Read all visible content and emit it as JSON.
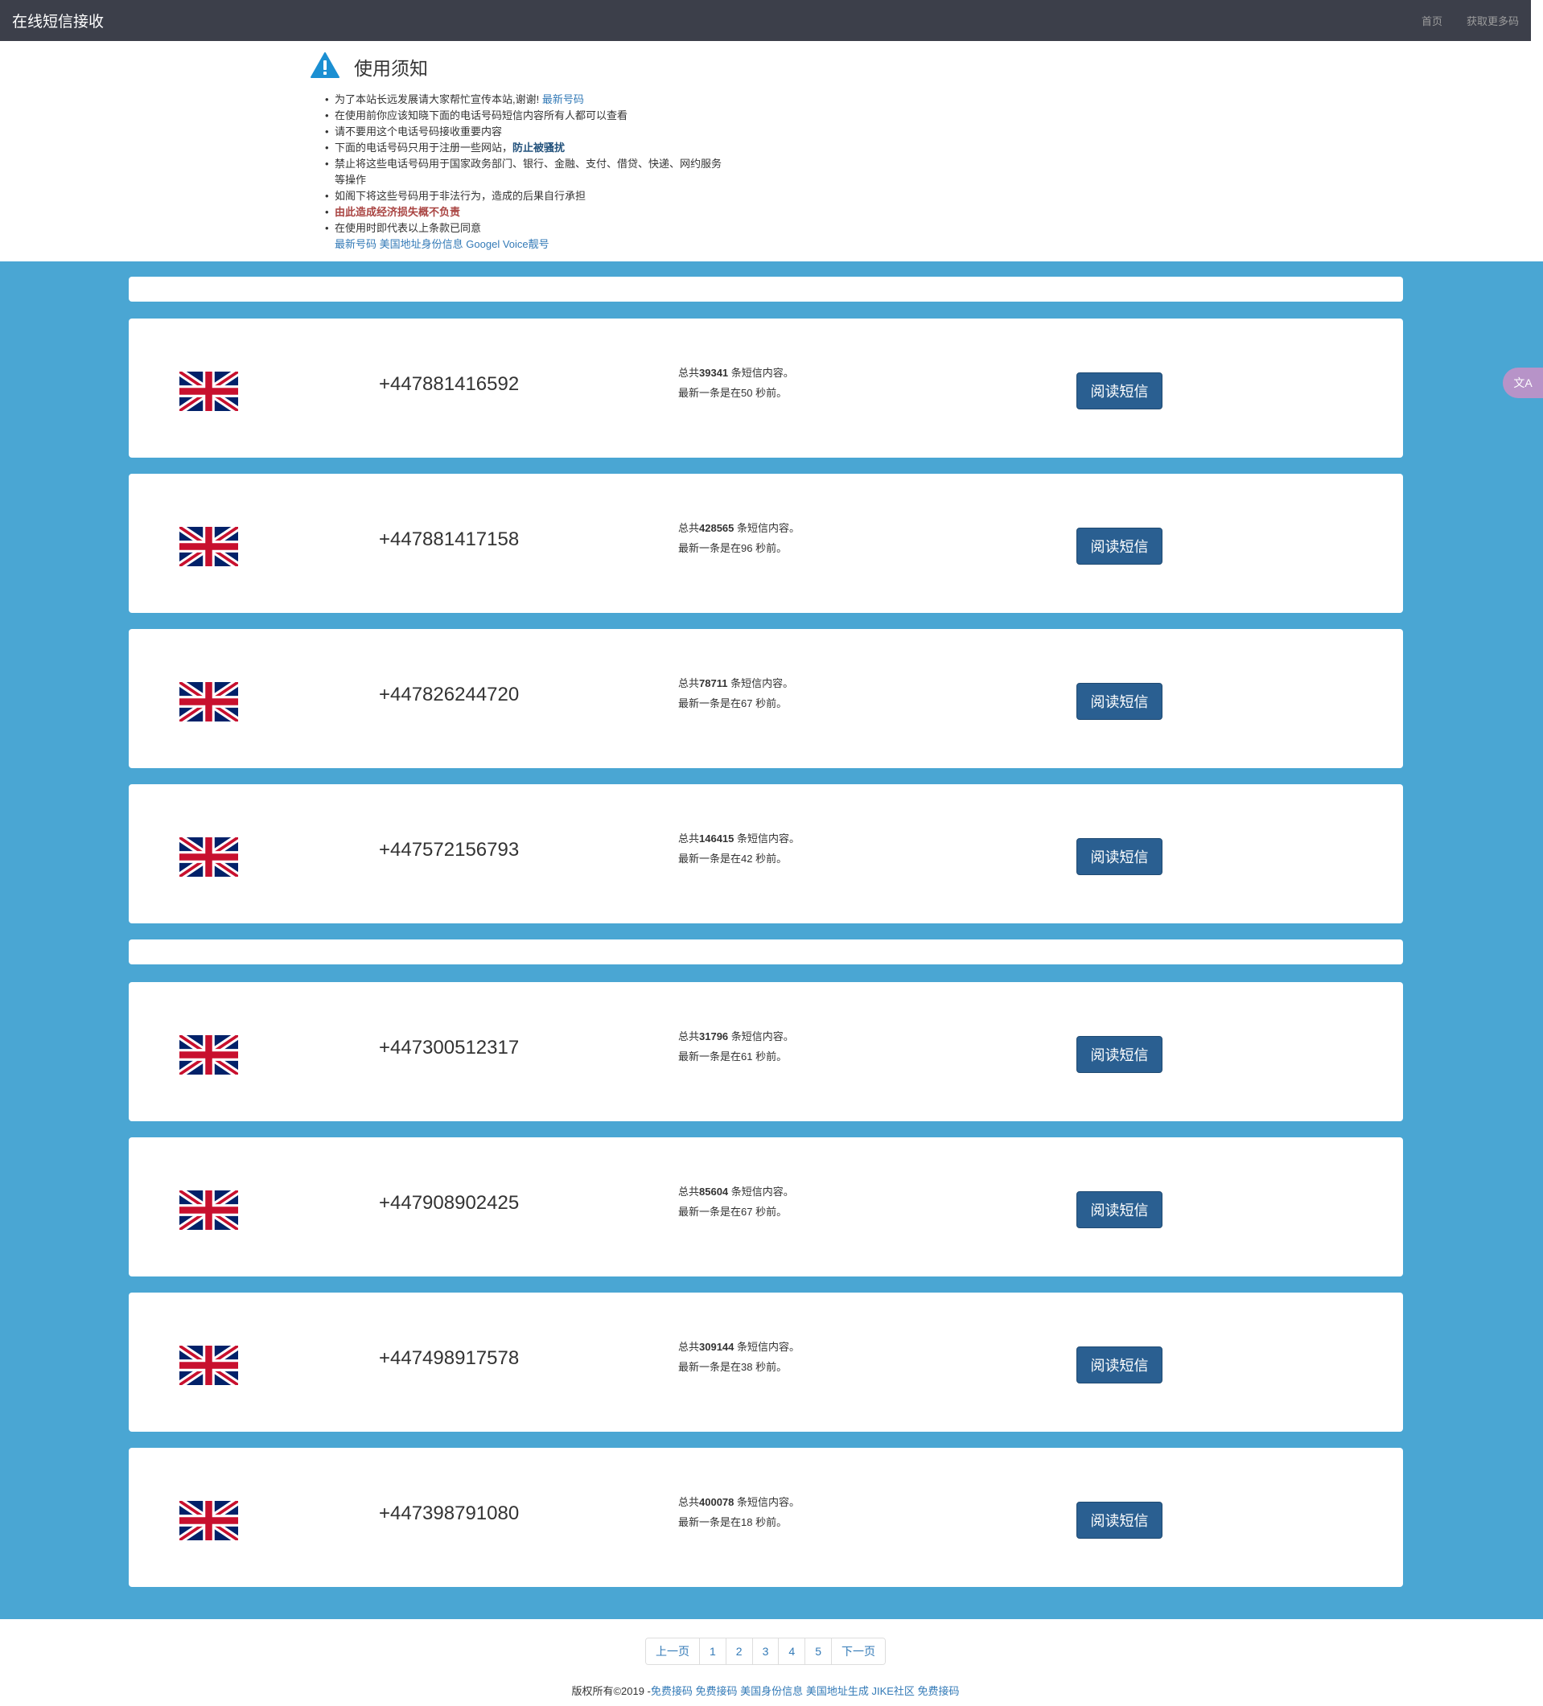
{
  "navbar": {
    "brand": "在线短信接收",
    "links": [
      "首页",
      "获取更多码"
    ]
  },
  "notice": {
    "title": "使用须知",
    "items": [
      {
        "text": "为了本站长远发展请大家帮忙宣传本站,谢谢!",
        "link": "最新号码"
      },
      {
        "text": "在使用前你应该知晓下面的电话号码短信内容所有人都可以查看"
      },
      {
        "text": "请不要用这个电话号码接收重要内容"
      },
      {
        "text": "下面的电话号码只用于注册一些网站，",
        "emph": "防止被骚扰"
      },
      {
        "text": "禁止将这些电话号码用于国家政务部门、银行、金融、支付、借贷、快递、网约服务"
      },
      {
        "text": "等操作"
      },
      {
        "text": "如阁下将这些号码用于非法行为，造成的后果自行承担"
      },
      {
        "text": "由此造成经济损失概不负责"
      },
      {
        "text": "在使用时即代表以上条款已同意"
      }
    ],
    "links": [
      "最新号码",
      "美国地址身份信息",
      "Googel Voice靓号"
    ]
  },
  "labels": {
    "total_prefix": "总共",
    "total_suffix": " 条短信内容。",
    "latest_prefix": "最新一条是在",
    "latest_suffix": " 秒前。",
    "read_button": "阅读短信"
  },
  "cards": [
    {
      "phone": "+447881416592",
      "total": "39341",
      "seconds": "50"
    },
    {
      "phone": "+447881417158",
      "total": "428565",
      "seconds": "96"
    },
    {
      "phone": "+447826244720",
      "total": "78711",
      "seconds": "67"
    },
    {
      "phone": "+447572156793",
      "total": "146415",
      "seconds": "42"
    },
    {
      "phone": "+447300512317",
      "total": "31796",
      "seconds": "61"
    },
    {
      "phone": "+447908902425",
      "total": "85604",
      "seconds": "67"
    },
    {
      "phone": "+447498917578",
      "total": "309144",
      "seconds": "38"
    },
    {
      "phone": "+447398791080",
      "total": "400078",
      "seconds": "18"
    }
  ],
  "side_widget": {
    "label": "文A"
  },
  "pagination": [
    "上一页",
    "1",
    "2",
    "3",
    "4",
    "5",
    "下一页"
  ],
  "footer": {
    "text": "版权所有©2019 -",
    "links": [
      "免费接码",
      "免费接码",
      "美国身份信息",
      "美国地址生成",
      "JIKE社区",
      "免费接码"
    ]
  },
  "colors": {
    "navbar": "#3c3f4a",
    "list_bg": "#4aa6d3",
    "button": "#2a5f91",
    "link": "#337ab7",
    "warning_red": "#a94442"
  }
}
